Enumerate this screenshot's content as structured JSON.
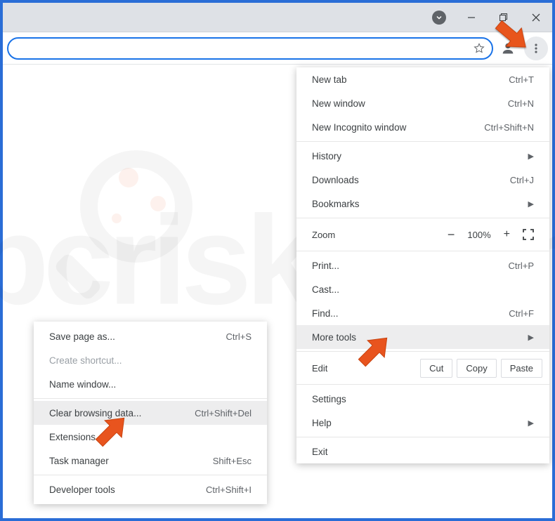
{
  "window": {
    "minimize": "—",
    "maximize": "❐",
    "close": "✕"
  },
  "menu": {
    "new_tab": "New tab",
    "new_tab_sc": "Ctrl+T",
    "new_window": "New window",
    "new_window_sc": "Ctrl+N",
    "new_incognito": "New Incognito window",
    "new_incognito_sc": "Ctrl+Shift+N",
    "history": "History",
    "downloads": "Downloads",
    "downloads_sc": "Ctrl+J",
    "bookmarks": "Bookmarks",
    "zoom_label": "Zoom",
    "zoom_minus": "−",
    "zoom_pct": "100%",
    "zoom_plus": "+",
    "print": "Print...",
    "print_sc": "Ctrl+P",
    "cast": "Cast...",
    "find": "Find...",
    "find_sc": "Ctrl+F",
    "more_tools": "More tools",
    "edit_label": "Edit",
    "cut": "Cut",
    "copy": "Copy",
    "paste": "Paste",
    "settings": "Settings",
    "help": "Help",
    "exit": "Exit"
  },
  "submenu": {
    "save_page": "Save page as...",
    "save_page_sc": "Ctrl+S",
    "create_shortcut": "Create shortcut...",
    "name_window": "Name window...",
    "clear_browsing": "Clear browsing data...",
    "clear_browsing_sc": "Ctrl+Shift+Del",
    "extensions": "Extensions",
    "task_manager": "Task manager",
    "task_manager_sc": "Shift+Esc",
    "dev_tools": "Developer tools",
    "dev_tools_sc": "Ctrl+Shift+I"
  }
}
